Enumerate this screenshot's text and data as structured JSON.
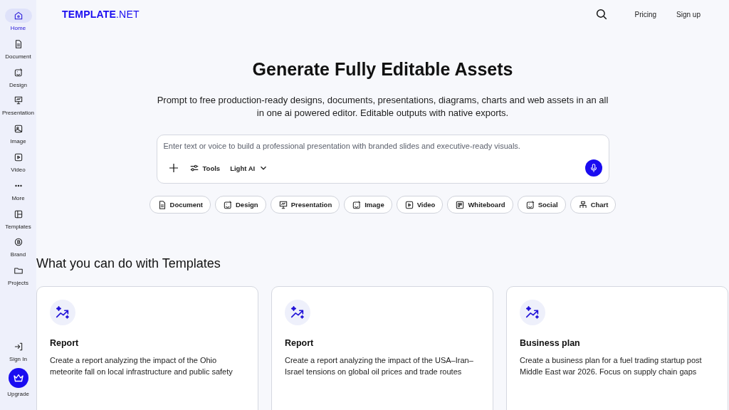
{
  "sidebar": {
    "items": [
      {
        "label": "Home",
        "selected": true
      },
      {
        "label": "Document",
        "selected": false
      },
      {
        "label": "Design",
        "selected": false
      },
      {
        "label": "Presentation",
        "selected": false
      },
      {
        "label": "Image",
        "selected": false
      },
      {
        "label": "Video",
        "selected": false
      },
      {
        "label": "More",
        "selected": false
      },
      {
        "label": "Templates",
        "selected": false
      },
      {
        "label": "Brand",
        "selected": false
      },
      {
        "label": "Projects",
        "selected": false
      }
    ],
    "sign_in": "Sign In",
    "upgrade": "Upgrade"
  },
  "header": {
    "logo": "**TEMPLATE**.NET",
    "links": [
      "Pricing",
      "Sign up"
    ]
  },
  "hero": {
    "title": "Generate Fully Editable Assets",
    "subtitle": "Prompt to free production-ready designs, documents, presentations, diagrams, charts and web assets in an all in one ai powered editor. Editable outputs with native exports."
  },
  "prompt": {
    "placeholder": "Enter text or voice to build a professional presentation with branded slides and executive-ready visuals.",
    "tools": "Tools",
    "model": "Light AI"
  },
  "chips": [
    "Document",
    "Design",
    "Presentation",
    "Image",
    "Video",
    "Whiteboard",
    "Social",
    "Chart"
  ],
  "section_title": "What you can do with Templates",
  "cards": [
    {
      "title": "Report",
      "description": "Create a report analyzing the impact of the Ohio meteorite fall on local infrastructure and public safety"
    },
    {
      "title": "Report",
      "description": "Create a report analyzing the impact of the USA–Iran–Israel tensions on global oil prices and trade routes"
    },
    {
      "title": "Business plan",
      "description": "Create a business plan for a fuel trading startup post Middle East war 2026. Focus on supply chain gaps"
    }
  ]
}
